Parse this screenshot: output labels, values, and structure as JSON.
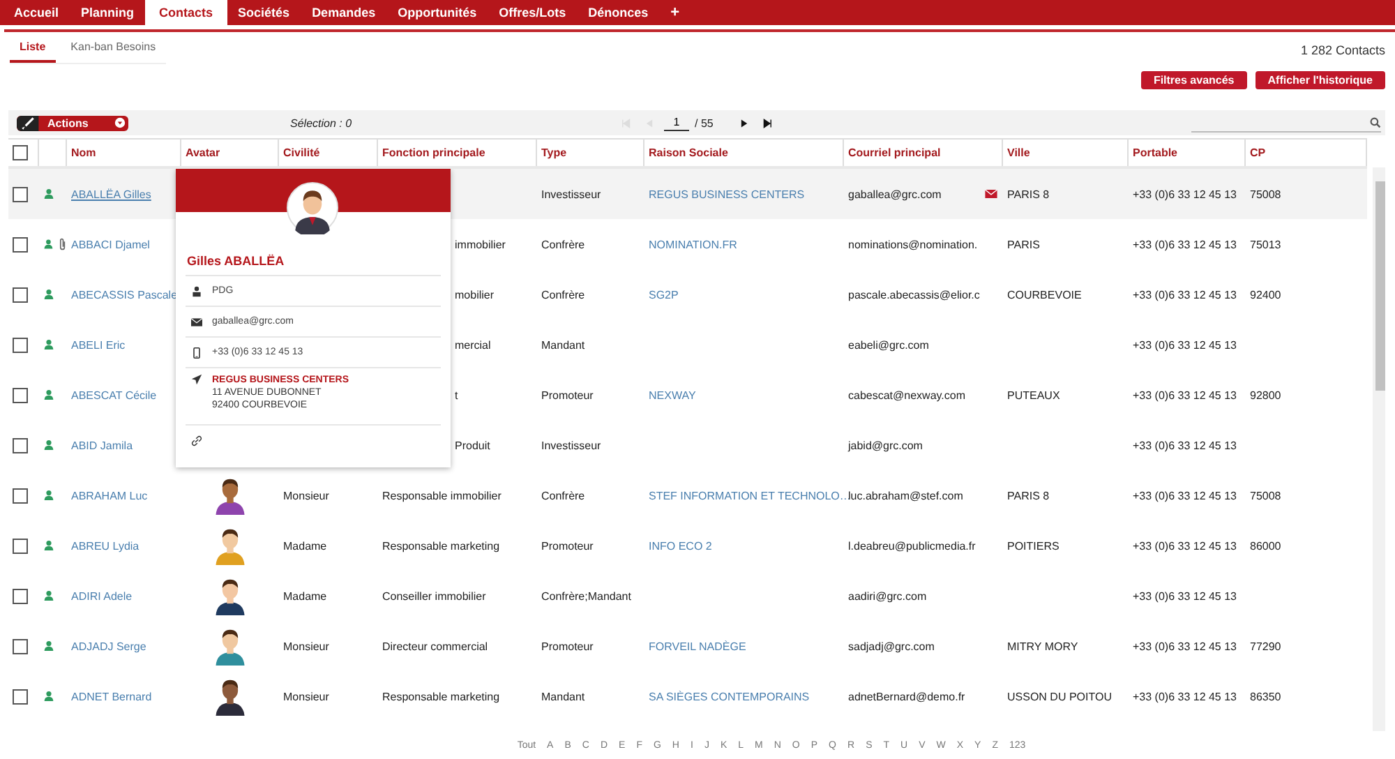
{
  "nav": {
    "tabs": [
      {
        "label": "Accueil",
        "selected": false
      },
      {
        "label": "Planning",
        "selected": false
      },
      {
        "label": "Contacts",
        "selected": true
      },
      {
        "label": "Sociétés",
        "selected": false
      },
      {
        "label": "Demandes",
        "selected": false
      },
      {
        "label": "Opportunités",
        "selected": false
      },
      {
        "label": "Offres/Lots",
        "selected": false
      },
      {
        "label": "Dénonces",
        "selected": false
      }
    ],
    "add": "+"
  },
  "subtabs": [
    {
      "label": "Liste",
      "selected": true
    },
    {
      "label": "Kan-ban Besoins",
      "selected": false
    }
  ],
  "count": "1 282 Contacts",
  "buttons": [
    "Filtres avancés",
    "Afficher l'historique"
  ],
  "toolbar": {
    "actions": "Actions",
    "selection": "Sélection : 0",
    "page": "1",
    "pages": "/ 55"
  },
  "table": {
    "select_all_checked": false,
    "columns": [
      "Nom",
      "Avatar",
      "Civilité",
      "Fonction principale",
      "Type",
      "Raison Sociale",
      "Courriel principal",
      "Ville",
      "Portable",
      "CP"
    ],
    "rows": [
      {
        "checked": false,
        "attachment": false,
        "highlighted": true,
        "nom": "ABALLËA Gilles",
        "avatar": false,
        "civilite": "",
        "fonction": "",
        "fonction_partial": true,
        "type": "Investisseur",
        "raison": "REGUS BUSINESS CENTERS",
        "courriel": "gaballea@grc.com",
        "mail_icon": true,
        "ville": "PARIS 8",
        "portable": "+33 (0)6 33 12 45 13",
        "cp": "75008"
      },
      {
        "checked": false,
        "attachment": true,
        "highlighted": false,
        "nom": "ABBACI Djamel",
        "avatar": false,
        "civilite": "",
        "fonction": "immobilier",
        "fonction_partial": true,
        "type": "Confrère",
        "raison": "NOMINATION.FR",
        "courriel": "nominations@nomination.",
        "mail_icon": false,
        "ville": "PARIS",
        "portable": "+33 (0)6 33 12 45 13",
        "cp": "75013"
      },
      {
        "checked": false,
        "attachment": false,
        "highlighted": false,
        "nom": "ABECASSIS Pascale",
        "avatar": false,
        "civilite": "",
        "fonction": "mobilier",
        "fonction_partial": true,
        "type": "Confrère",
        "raison": "SG2P",
        "courriel": "pascale.abecassis@elior.c",
        "mail_icon": false,
        "ville": "COURBEVOIE",
        "portable": "+33 (0)6 33 12 45 13",
        "cp": "92400"
      },
      {
        "checked": false,
        "attachment": false,
        "highlighted": false,
        "nom": "ABELI Eric",
        "avatar": false,
        "civilite": "",
        "fonction": "mercial",
        "fonction_partial": true,
        "type": "Mandant",
        "raison": "",
        "courriel": "eabeli@grc.com",
        "mail_icon": false,
        "ville": "",
        "portable": "+33 (0)6 33 12 45 13",
        "cp": ""
      },
      {
        "checked": false,
        "attachment": false,
        "highlighted": false,
        "nom": "ABESCAT Cécile",
        "avatar": false,
        "civilite": "",
        "fonction": "t",
        "fonction_partial": true,
        "type": "Promoteur",
        "raison": "NEXWAY",
        "courriel": "cabescat@nexway.com",
        "mail_icon": false,
        "ville": "PUTEAUX",
        "portable": "+33 (0)6 33 12 45 13",
        "cp": "92800"
      },
      {
        "checked": false,
        "attachment": false,
        "highlighted": false,
        "nom": "ABID Jamila",
        "avatar": false,
        "civilite": "",
        "fonction": "Produit",
        "fonction_partial": true,
        "type": "Investisseur",
        "raison": "",
        "courriel": "jabid@grc.com",
        "mail_icon": false,
        "ville": "",
        "portable": "+33 (0)6 33 12 45 13",
        "cp": ""
      },
      {
        "checked": false,
        "attachment": false,
        "highlighted": false,
        "nom": "ABRAHAM Luc",
        "avatar": true,
        "civilite": "Monsieur",
        "fonction": "Responsable immobilier",
        "fonction_partial": false,
        "type": "Confrère",
        "raison": "STEF INFORMATION ET TECHNOLO…",
        "courriel": "luc.abraham@stef.com",
        "mail_icon": false,
        "ville": "PARIS 8",
        "portable": "+33 (0)6 33 12 45 13",
        "cp": "75008"
      },
      {
        "checked": false,
        "attachment": false,
        "highlighted": false,
        "nom": "ABREU Lydia",
        "avatar": true,
        "civilite": "Madame",
        "fonction": "Responsable marketing",
        "fonction_partial": false,
        "type": "Promoteur",
        "raison": "INFO ECO 2",
        "courriel": "l.deabreu@publicmedia.fr",
        "mail_icon": false,
        "ville": "POITIERS",
        "portable": "+33 (0)6 33 12 45 13",
        "cp": "86000"
      },
      {
        "checked": false,
        "attachment": false,
        "highlighted": false,
        "nom": "ADIRI Adele",
        "avatar": true,
        "civilite": "Madame",
        "fonction": "Conseiller immobilier",
        "fonction_partial": false,
        "type": "Confrère;Mandant",
        "raison": "",
        "courriel": "aadiri@grc.com",
        "mail_icon": false,
        "ville": "",
        "portable": "+33 (0)6 33 12 45 13",
        "cp": ""
      },
      {
        "checked": false,
        "attachment": false,
        "highlighted": false,
        "nom": "ADJADJ Serge",
        "avatar": true,
        "civilite": "Monsieur",
        "fonction": "Directeur commercial",
        "fonction_partial": false,
        "type": "Promoteur",
        "raison": "FORVEIL NADÈGE",
        "courriel": "sadjadj@grc.com",
        "mail_icon": false,
        "ville": "MITRY MORY",
        "portable": "+33 (0)6 33 12 45 13",
        "cp": "77290"
      },
      {
        "checked": false,
        "attachment": false,
        "highlighted": false,
        "nom": "ADNET Bernard",
        "avatar": true,
        "civilite": "Monsieur",
        "fonction": "Responsable marketing",
        "fonction_partial": false,
        "type": "Mandant",
        "raison": "SA SIÈGES CONTEMPORAINS",
        "courriel": "adnetBernard@demo.fr",
        "mail_icon": false,
        "ville": "USSON DU POITOU",
        "portable": "+33 (0)6 33 12 45 13",
        "cp": "86350"
      }
    ]
  },
  "popup": {
    "name": "Gilles ABALLËA",
    "role": "PDG",
    "email": "gaballea@grc.com",
    "phone": "+33 (0)6 33 12 45 13",
    "company": "REGUS BUSINESS CENTERS",
    "address": [
      "11 AVENUE DUBONNET",
      "92400 COURBEVOIE"
    ]
  },
  "alphabet": [
    "Tout",
    "A",
    "B",
    "C",
    "D",
    "E",
    "F",
    "G",
    "H",
    "I",
    "J",
    "K",
    "L",
    "M",
    "N",
    "O",
    "P",
    "Q",
    "R",
    "S",
    "T",
    "U",
    "V",
    "W",
    "X",
    "Y",
    "Z",
    "123"
  ]
}
